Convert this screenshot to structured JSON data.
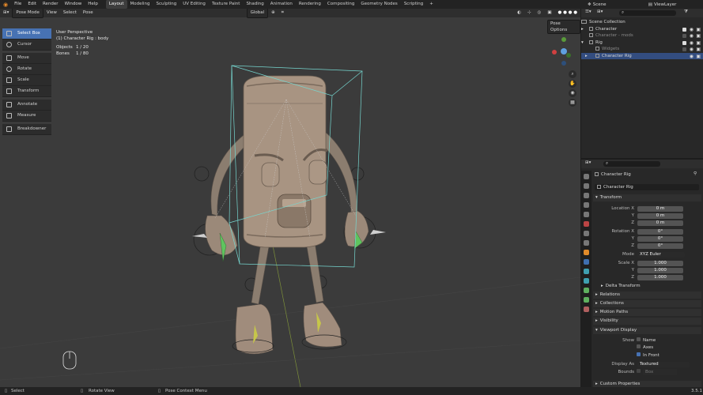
{
  "topbar": {
    "menus": [
      "File",
      "Edit",
      "Render",
      "Window",
      "Help"
    ],
    "workspaces": [
      "Layout",
      "Modeling",
      "Sculpting",
      "UV Editing",
      "Texture Paint",
      "Shading",
      "Animation",
      "Rendering",
      "Compositing",
      "Geometry Nodes",
      "Scripting"
    ],
    "active_workspace": "Layout",
    "add_tab": "+",
    "scene": "Scene",
    "view_layer": "ViewLayer"
  },
  "viewport_header": {
    "mode": "Pose Mode",
    "menus": [
      "View",
      "Select",
      "Pose"
    ],
    "orientation": "Global",
    "pose_options": "Pose Options"
  },
  "info": {
    "view": "User Perspective",
    "object": "(1) Character Rig : body",
    "objects_label": "Objects",
    "objects_value": "1 / 20",
    "bones_label": "Bones",
    "bones_value": "1 / 80"
  },
  "toolbar": {
    "tools": [
      "Select Box",
      "Cursor",
      "Move",
      "Rotate",
      "Scale",
      "Transform",
      "Annotate",
      "Measure",
      "Breakdowner"
    ],
    "active": "Select Box"
  },
  "outliner": {
    "rows": [
      "Scene Collection",
      "Character",
      "Character - mods",
      "Rig",
      "Widgets",
      "Character Rig"
    ]
  },
  "properties": {
    "object_name": "Character Rig",
    "data_name": "Character Rig",
    "transform_header": "Transform",
    "location_label": "Location X",
    "location": [
      "0 m",
      "0 m",
      "0 m"
    ],
    "rotation_label": "Rotation X",
    "rotation": [
      "0°",
      "0°",
      "0°"
    ],
    "mode_label": "Mode",
    "mode_value": "XYZ Euler",
    "scale_label": "Scale X",
    "scale": [
      "1.000",
      "1.000",
      "1.000"
    ],
    "axis_y": "Y",
    "axis_z": "Z",
    "delta_transform": "Delta Transform",
    "panels": [
      "Relations",
      "Collections",
      "Motion Paths",
      "Visibility"
    ],
    "viewport_display": "Viewport Display",
    "show_label": "Show",
    "name_opt": "Name",
    "axes_opt": "Axes",
    "in_front_opt": "In Front",
    "display_as_label": "Display As",
    "display_as_value": "Textured",
    "bounds_label": "Bounds",
    "bounds_value": "Box",
    "custom_properties": "Custom Properties"
  },
  "statusbar": {
    "select": "Select",
    "rotate_view": "Rotate View",
    "context_menu": "Pose Context Menu",
    "version": "3.5.1"
  },
  "colors": {
    "accent": "#4772b3",
    "bbox": "#76d7d0",
    "bone_green": "#5fc45f"
  }
}
